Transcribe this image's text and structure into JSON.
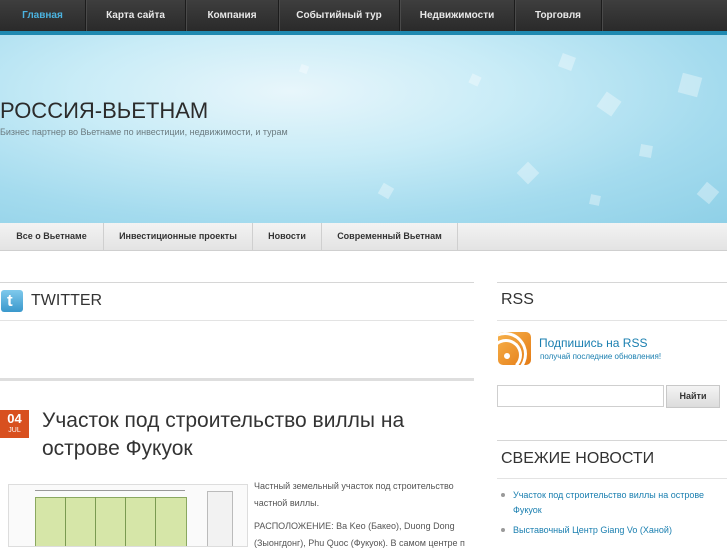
{
  "top_nav": {
    "items": [
      {
        "label": "Главная",
        "active": true
      },
      {
        "label": "Карта сайта"
      },
      {
        "label": "Компания"
      },
      {
        "label": "Событийный тур"
      },
      {
        "label": "Недвижимости"
      },
      {
        "label": "Торговля"
      }
    ]
  },
  "header": {
    "title": "РОССИЯ-ВЬЕТНАМ",
    "tagline": "Бизнес партнер во Вьетнаме по инвестиции, недвижимости, и турам"
  },
  "sub_nav": {
    "items": [
      {
        "label": "Все о Вьетнаме"
      },
      {
        "label": "Инвестиционные проекты"
      },
      {
        "label": "Новости"
      },
      {
        "label": "Современный Вьетнам"
      }
    ]
  },
  "twitter_widget": {
    "title": "TWITTER",
    "icon": "twitter-icon"
  },
  "post": {
    "date_day": "04",
    "date_month": "JUL",
    "title": "Участок под строительство виллы на острове Фукуок",
    "excerpt_1": "Частный земельный участок под строительство частной виллы.",
    "excerpt_2": "РАСПОЛОЖЕНИЕ:  Ba Keo (Бакео), Duong Dong (Зыонгдонг), Phu Quoc (Фукуок). В самом центре п"
  },
  "sidebar": {
    "rss": {
      "title": "RSS",
      "icon": "rss-icon",
      "link": "Подпишись на RSS",
      "subtitle": "получай последние обновления!"
    },
    "search": {
      "value": "",
      "placeholder": "",
      "button_label": "Найти"
    },
    "news": {
      "title": "СВЕЖИЕ НОВОСТИ",
      "items": [
        {
          "label": "Участок под строительство виллы на острове Фукуок"
        },
        {
          "label": "Выставочный Центр Giang Vo (Ханой)"
        }
      ]
    }
  },
  "colors": {
    "nav_accent": "#1f89b0",
    "date_badge": "#d8501f",
    "link": "#1a7fb0"
  }
}
